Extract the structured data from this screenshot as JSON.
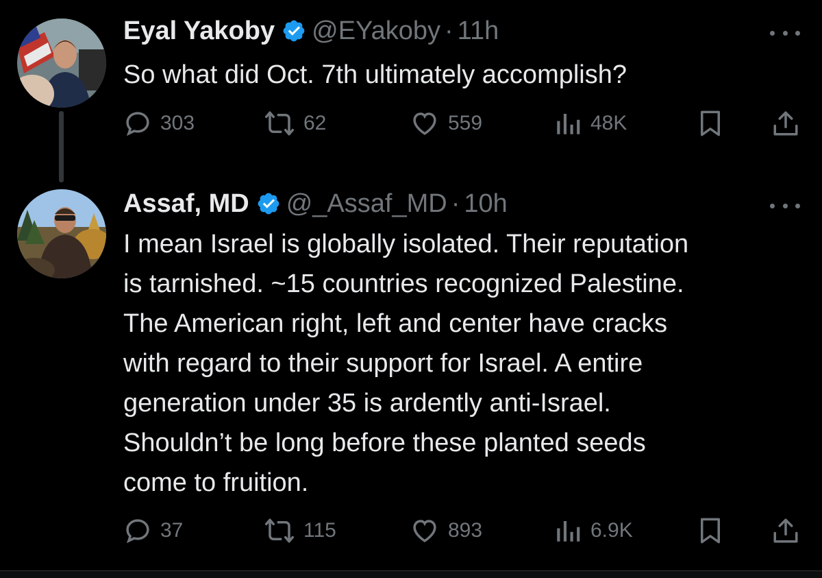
{
  "tweets": [
    {
      "name": "Eyal Yakoby",
      "handle": "@EYakoby",
      "separator": "·",
      "time": "11h",
      "text": [
        "So what did Oct. 7th ultimately accomplish?"
      ],
      "stats": {
        "replies": "303",
        "reposts": "62",
        "likes": "559",
        "views": "48K"
      }
    },
    {
      "name": "Assaf, MD",
      "handle": "@_Assaf_MD",
      "separator": "·",
      "time": "10h",
      "text": [
        "I mean Israel is globally isolated. Their reputation",
        "is tarnished. ~15 countries recognized Palestine.",
        "The American right, left and center have cracks",
        "with regard to their support for Israel. A entire",
        "generation under 35 is ardently anti-Israel.",
        "Shouldn’t be long before these planted seeds",
        "come to fruition."
      ],
      "stats": {
        "replies": "37",
        "reposts": "115",
        "likes": "893",
        "views": "6.9K"
      }
    }
  ],
  "icons": {
    "verified": "verified-badge-icon",
    "reply": "reply-icon",
    "repost": "repost-icon",
    "like": "like-icon",
    "views": "views-icon",
    "bookmark": "bookmark-icon",
    "share": "share-icon",
    "more": "more-icon"
  },
  "colors": {
    "background": "#000000",
    "text": "#e7e9ea",
    "muted": "#71767b",
    "verified": "#1d9bf0",
    "thread_line": "#333639"
  }
}
